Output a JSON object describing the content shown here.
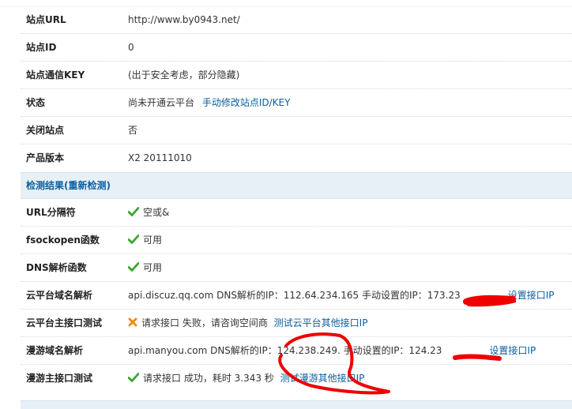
{
  "site": {
    "url_label": "站点URL",
    "url_value": "http://www.by0943.net/",
    "id_label": "站点ID",
    "id_value": "0",
    "key_label": "站点通信KEY",
    "key_value": "(出于安全考虑，部分隐藏)",
    "status_label": "状态",
    "status_value": "尚未开通云平台",
    "status_link": "手动修改站点ID/KEY",
    "closed_label": "关闭站点",
    "closed_value": "否",
    "version_label": "产品版本",
    "version_value": "X2 20111010"
  },
  "results": {
    "header_title": "检测结果",
    "header_recheck_link": "(重新检测)",
    "url_sep_label": "URL分隔符",
    "url_sep_value": "空或&",
    "fsock_label": "fsockopen函数",
    "fsock_value": "可用",
    "dns_label": "DNS解析函数",
    "dns_value": "可用",
    "cloud_domain_label": "云平台域名解析",
    "cloud_domain_value": "api.discuz.qq.com DNS解析的IP：112.64.234.165 手动设置的IP：173.23",
    "cloud_domain_link": "设置接口IP",
    "cloud_api_label": "云平台主接口测试",
    "cloud_api_value": "请求接口 失败，请咨询空间商",
    "cloud_api_link": "测试云平台其他接口IP",
    "manyou_domain_label": "漫游域名解析",
    "manyou_domain_value": "api.manyou.com DNS解析的IP：124.238.249.  手动设置的IP：124.23",
    "manyou_domain_link": "设置接口IP",
    "manyou_api_label": "漫游主接口测试",
    "manyou_api_value": "请求接口 成功，耗时 3.343 秒",
    "manyou_api_link": "测试漫游其他接口IP"
  },
  "icons": {
    "ok": "check-icon",
    "fail": "x-icon"
  },
  "colors": {
    "link": "#0b5ea0",
    "header_bg": "#e8f0f7",
    "ok_green": "#3aa72f",
    "fail_orange": "#f08a00",
    "annotation_red": "#ee0000"
  }
}
